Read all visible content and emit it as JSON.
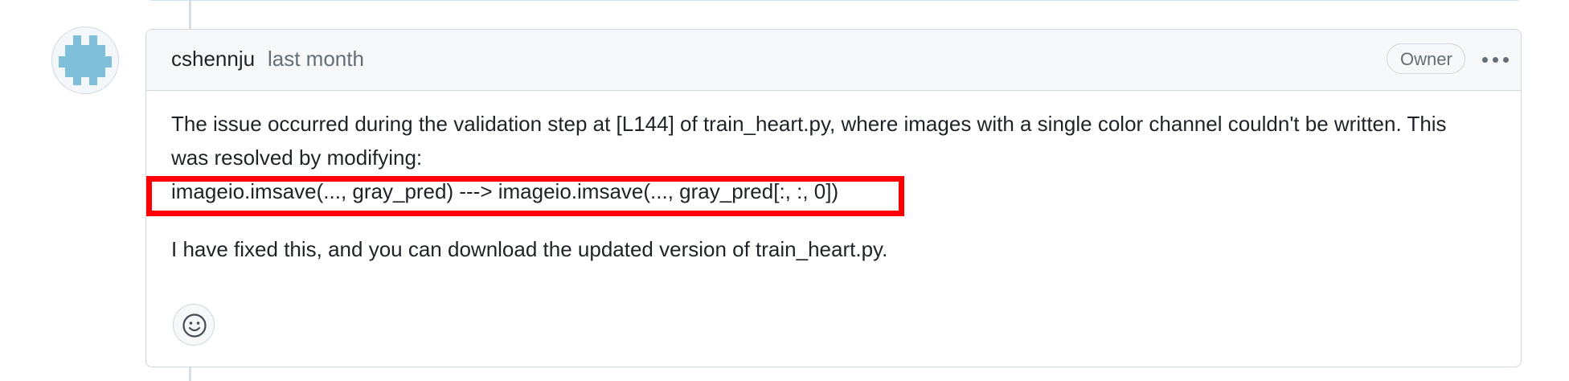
{
  "comment": {
    "author": "cshennju",
    "time": "last month",
    "badge": "Owner",
    "body": {
      "paragraph1": "The issue occurred during the validation step at [L144] of train_heart.py, where images with a single color channel couldn't be written. This was resolved by modifying:",
      "code_line": "imageio.imsave(..., gray_pred) ---> imageio.imsave(..., gray_pred[:, :, 0])",
      "paragraph2": "I have fixed this, and you can download the updated version of train_heart.py."
    }
  },
  "icons": {
    "avatar": "identicon-avatar",
    "menu": "kebab-horizontal-icon",
    "reaction": "smiley-icon"
  },
  "colors": {
    "highlight_border": "#ff0000",
    "avatar_fill": "#7fbfd9",
    "header_bg": "#f6f8fa"
  }
}
